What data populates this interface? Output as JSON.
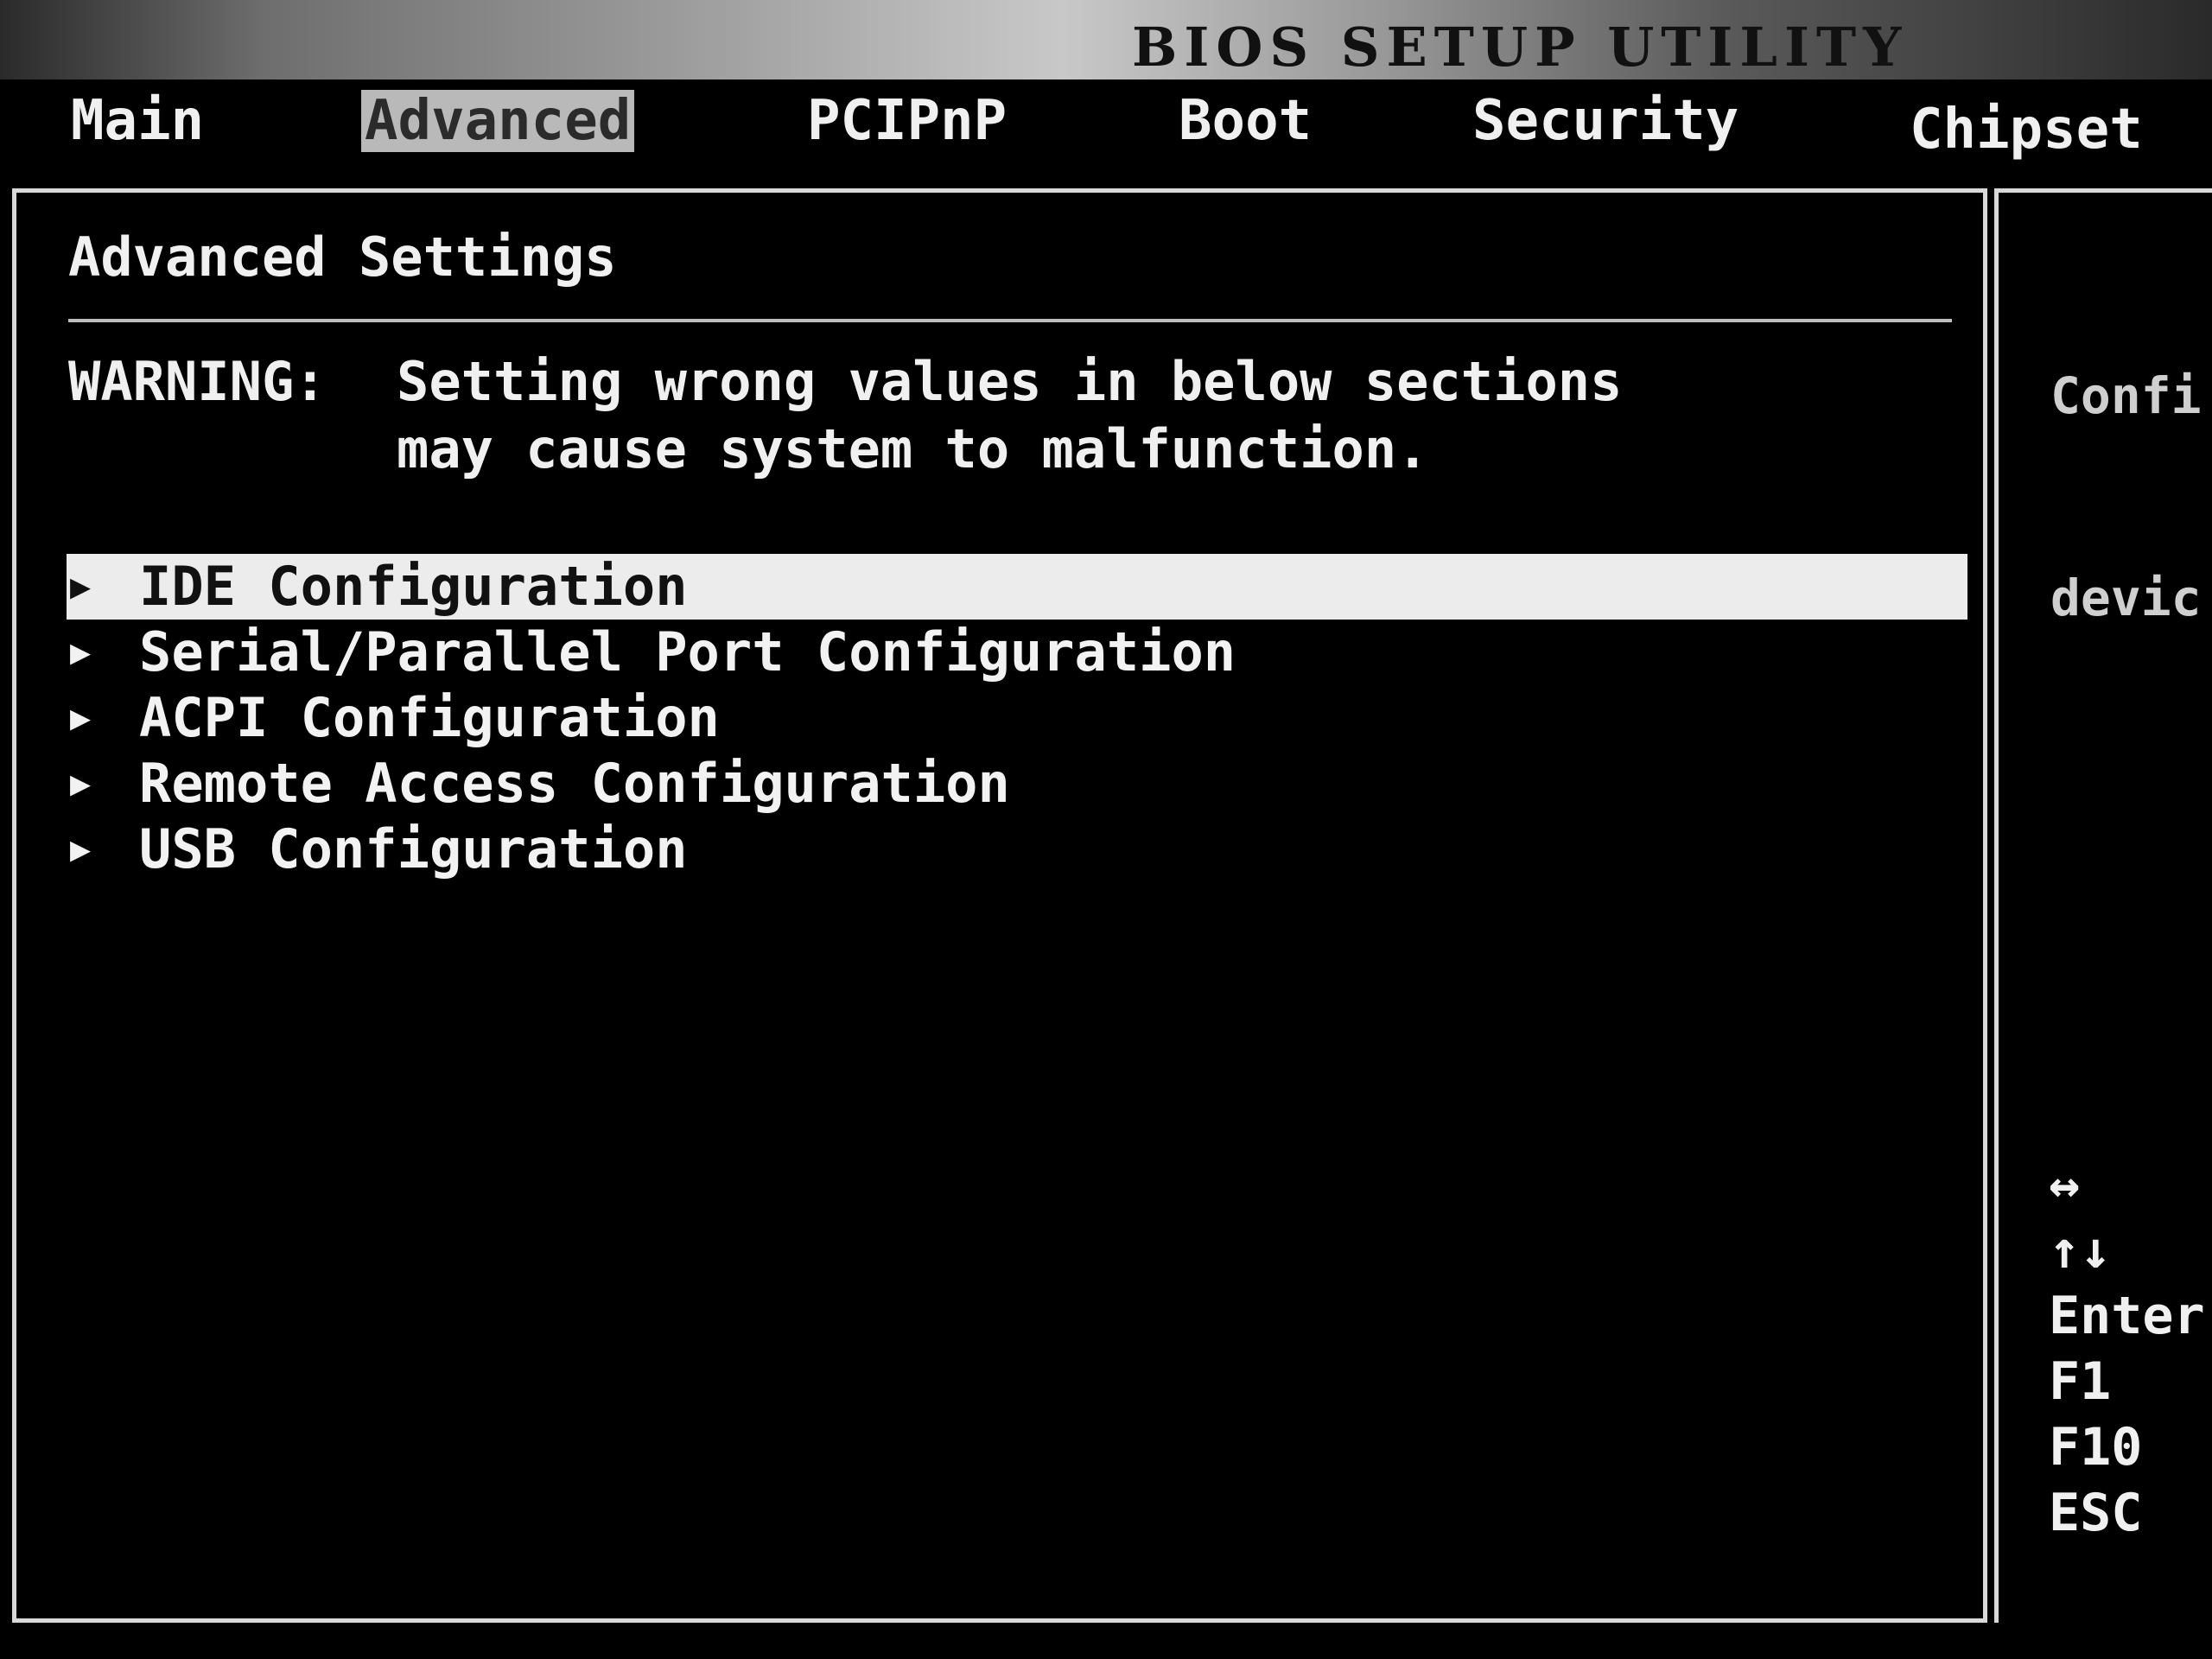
{
  "window": {
    "title": "BIOS SETUP UTILITY"
  },
  "menu": {
    "tabs": [
      {
        "label": "Main"
      },
      {
        "label": "Advanced"
      },
      {
        "label": "PCIPnP"
      },
      {
        "label": "Boot"
      },
      {
        "label": "Security"
      },
      {
        "label": "Chipset"
      }
    ],
    "active": "Advanced"
  },
  "main": {
    "heading": "Advanced Settings",
    "warning_label": "WARNING:",
    "warning_line1": "Setting wrong values in below sections",
    "warning_line2": "may cause system to malfunction.",
    "items": [
      {
        "label": "IDE Configuration",
        "selected": true
      },
      {
        "label": "Serial/Parallel Port Configuration",
        "selected": false
      },
      {
        "label": "ACPI Configuration",
        "selected": false
      },
      {
        "label": "Remote Access Configuration",
        "selected": false
      },
      {
        "label": "USB Configuration",
        "selected": false
      }
    ]
  },
  "side": {
    "help_line1": "Confi",
    "help_line2": "devic",
    "keys": [
      "↔",
      "↑↓",
      "Enter",
      "F1",
      "F10",
      "ESC"
    ]
  },
  "colors": {
    "background": "#000000",
    "text": "#f0f0f0",
    "highlight": "#ececec",
    "active_tab": "#b9b9b9"
  }
}
